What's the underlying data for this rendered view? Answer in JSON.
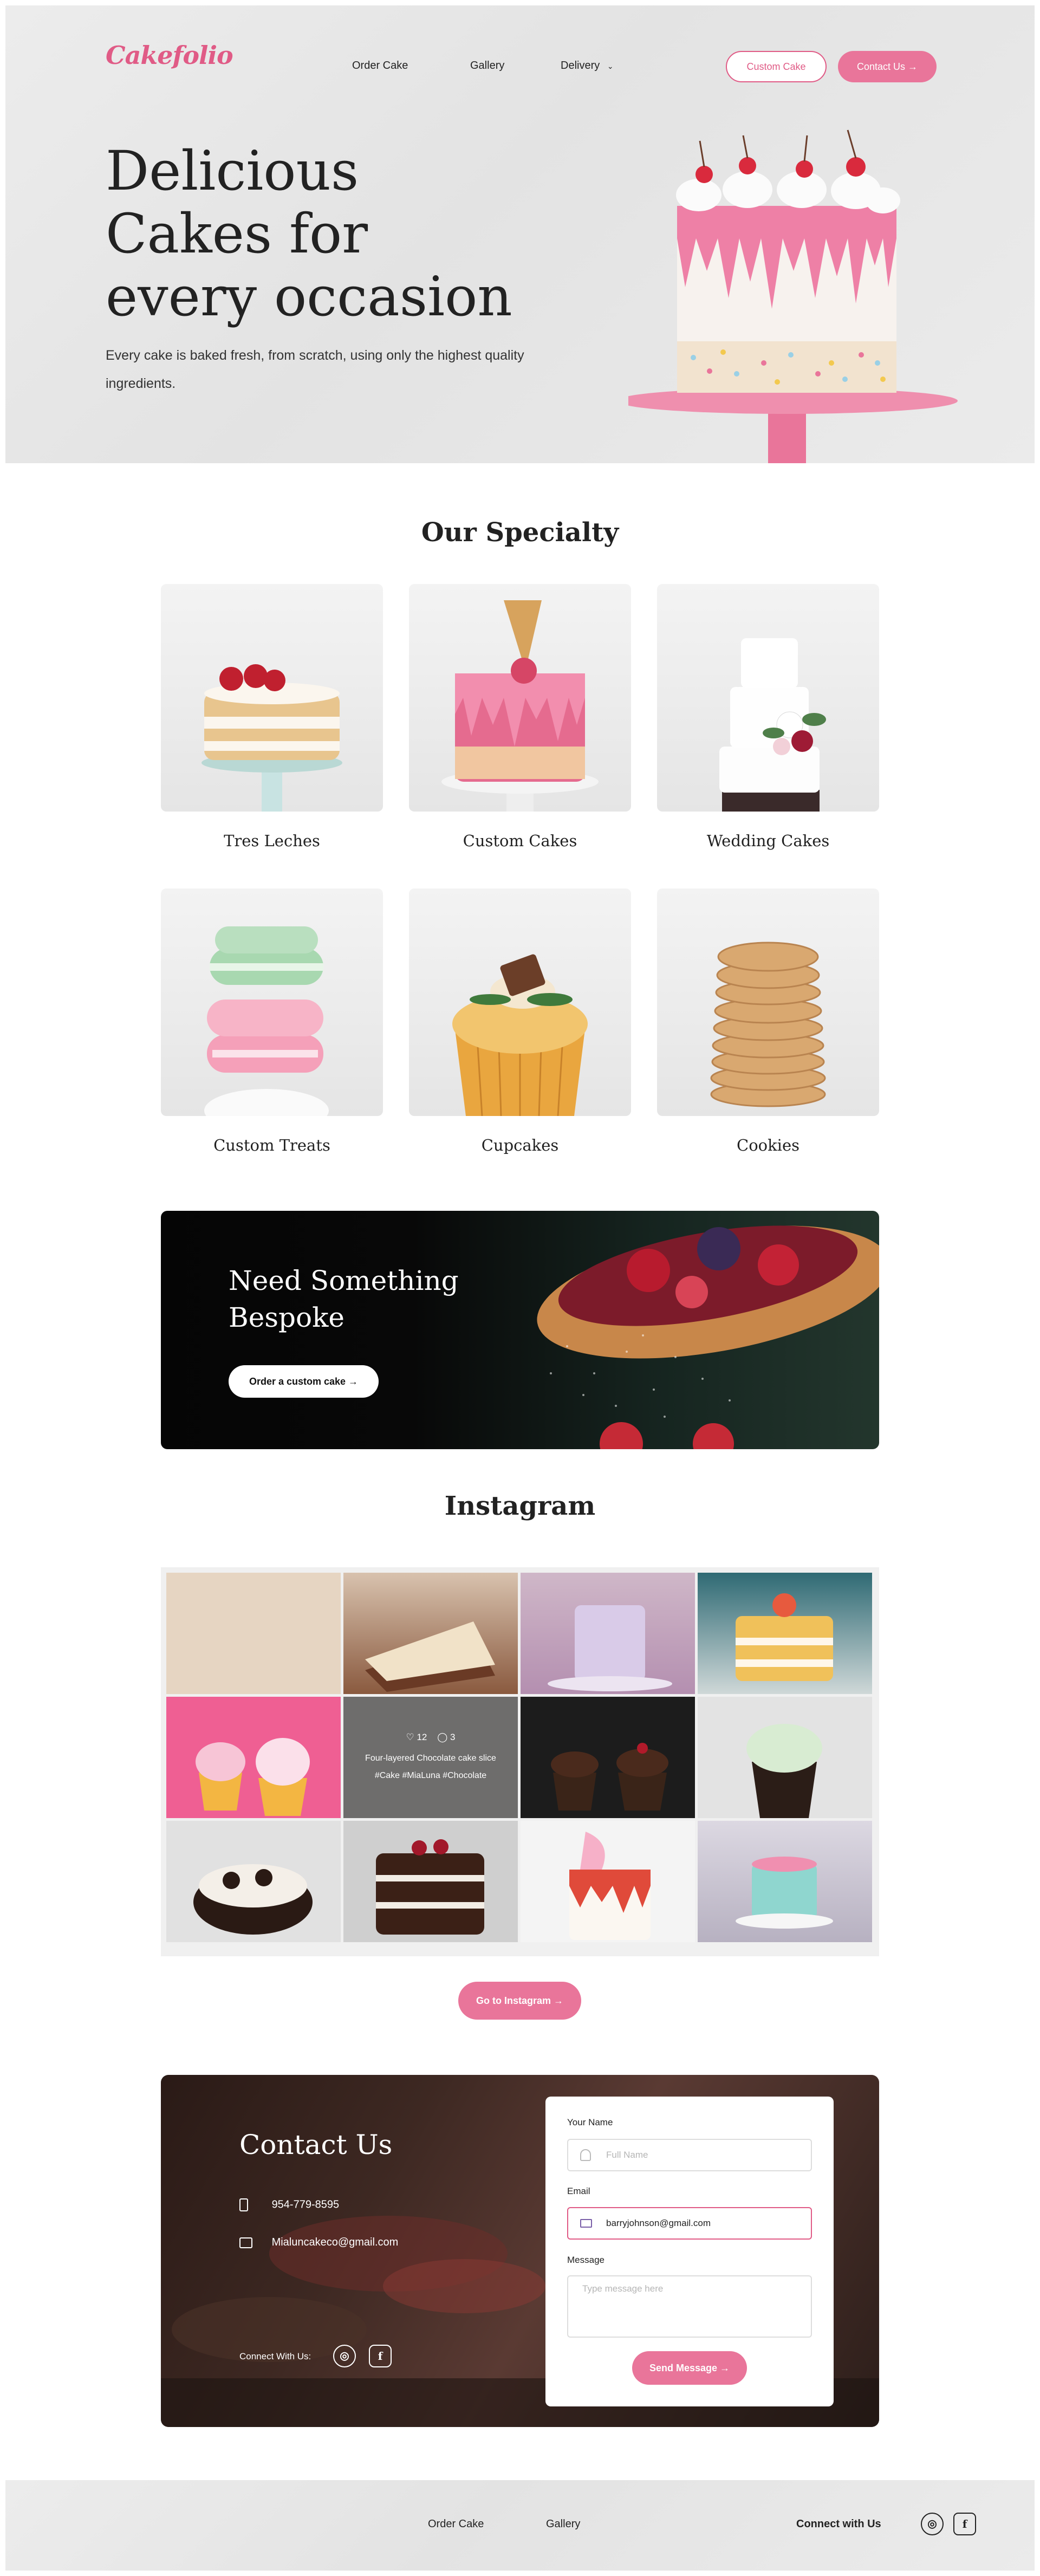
{
  "header": {
    "logo": "Cakefolio",
    "nav": [
      "Order Cake",
      "Gallery",
      "Delivery"
    ],
    "custom_cake_button": "Custom Cake",
    "contact_button": "Contact Us"
  },
  "hero": {
    "title_line1": "Delicious",
    "title_line2": "Cakes for",
    "title_line3": "every occasion",
    "text": "Every cake is baked fresh, from scratch, using only the highest quality ingredients."
  },
  "specialty": {
    "title": "Our Specialty",
    "items": [
      "Tres Leches",
      "Custom Cakes",
      "Wedding Cakes",
      "Custom Treats",
      "Cupcakes",
      "Cookies"
    ]
  },
  "bespoke": {
    "title_line1": "Need Something",
    "title_line2": "Bespoke",
    "button": "Order a custom cake"
  },
  "instagram": {
    "title": "Instagram",
    "overlay": {
      "likes": "12",
      "comments": "3",
      "caption": "Four-layered Chocolate cake slice",
      "tags": "#Cake #MiaLuna #Chocolate"
    },
    "button": "Go to Instagram"
  },
  "contact": {
    "title": "Contact Us",
    "phone": "954-779-8595",
    "email": "Mialuncakeco@gmail.com",
    "connect_label": "Connect With Us:",
    "form": {
      "name_label": "Your Name",
      "name_placeholder": "Full Name",
      "email_label": "Email",
      "email_value": "barryjohnson@gmail.com",
      "message_label": "Message",
      "message_placeholder": "Type message here",
      "send_button": "Send Message"
    }
  },
  "footer": {
    "links": [
      "Order Cake",
      "Gallery"
    ],
    "connect_label": "Connect with Us"
  },
  "colors": {
    "brand_pink": "#e9759a",
    "logo_pink": "#e05b86",
    "dark": "#222222"
  }
}
